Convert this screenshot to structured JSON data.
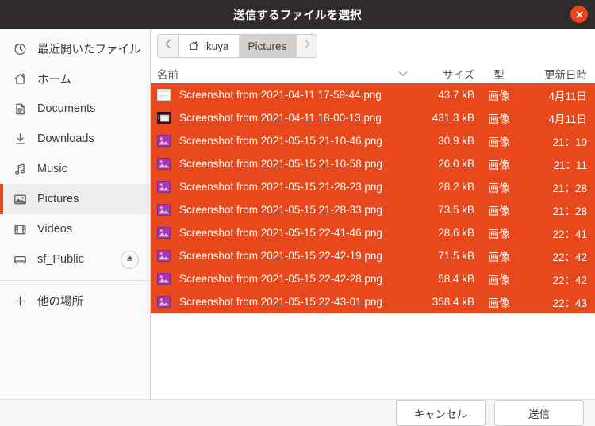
{
  "window": {
    "title": "送信するファイルを選択",
    "close_icon": "close-icon"
  },
  "sidebar": {
    "items": [
      {
        "label": "最近開いたファイル",
        "icon": "clock-icon",
        "selected": false,
        "eject": false
      },
      {
        "label": "ホーム",
        "icon": "home-icon",
        "selected": false,
        "eject": false
      },
      {
        "label": "Documents",
        "icon": "document-icon",
        "selected": false,
        "eject": false
      },
      {
        "label": "Downloads",
        "icon": "download-icon",
        "selected": false,
        "eject": false
      },
      {
        "label": "Music",
        "icon": "music-note-icon",
        "selected": false,
        "eject": false
      },
      {
        "label": "Pictures",
        "icon": "picture-icon",
        "selected": true,
        "eject": false
      },
      {
        "label": "Videos",
        "icon": "film-icon",
        "selected": false,
        "eject": false
      },
      {
        "label": "sf_Public",
        "icon": "drive-icon",
        "selected": false,
        "eject": true
      }
    ],
    "other_locations": {
      "label": "他の場所",
      "icon": "plus-icon"
    }
  },
  "pathbar": {
    "back_icon": "chevron-left-icon",
    "forward_icon": "chevron-right-icon",
    "crumbs": [
      {
        "label": "ikuya",
        "icon": "home-icon",
        "active": false
      },
      {
        "label": "Pictures",
        "icon": "",
        "active": true
      }
    ]
  },
  "columns": {
    "name": "名前",
    "size": "サイズ",
    "type": "型",
    "modified": "更新日時",
    "sort_icon": "chevron-down-icon"
  },
  "files": [
    {
      "name": "Screenshot from 2021-04-11 17-59-44.png",
      "size": "43.7 kB",
      "type": "画像",
      "modified": "4月11日",
      "thumb": "window-light",
      "selected": true
    },
    {
      "name": "Screenshot from 2021-04-11 18-00-13.png",
      "size": "431.3 kB",
      "type": "画像",
      "modified": "4月11日",
      "thumb": "desktop-dark",
      "selected": true
    },
    {
      "name": "Screenshot from 2021-05-15 21-10-46.png",
      "size": "30.9 kB",
      "type": "画像",
      "modified": "21：10",
      "thumb": "image-purple",
      "selected": true
    },
    {
      "name": "Screenshot from 2021-05-15 21-10-58.png",
      "size": "26.0 kB",
      "type": "画像",
      "modified": "21：11",
      "thumb": "image-purple",
      "selected": true
    },
    {
      "name": "Screenshot from 2021-05-15 21-28-23.png",
      "size": "28.2 kB",
      "type": "画像",
      "modified": "21：28",
      "thumb": "image-purple",
      "selected": true
    },
    {
      "name": "Screenshot from 2021-05-15 21-28-33.png",
      "size": "73.5 kB",
      "type": "画像",
      "modified": "21：28",
      "thumb": "image-purple",
      "selected": true
    },
    {
      "name": "Screenshot from 2021-05-15 22-41-46.png",
      "size": "28.6 kB",
      "type": "画像",
      "modified": "22：41",
      "thumb": "image-purple",
      "selected": true
    },
    {
      "name": "Screenshot from 2021-05-15 22-42-19.png",
      "size": "71.5 kB",
      "type": "画像",
      "modified": "22：42",
      "thumb": "image-purple",
      "selected": true
    },
    {
      "name": "Screenshot from 2021-05-15 22-42-28.png",
      "size": "58.4 kB",
      "type": "画像",
      "modified": "22：42",
      "thumb": "image-purple",
      "selected": true
    },
    {
      "name": "Screenshot from 2021-05-15 22-43-01.png",
      "size": "358.4 kB",
      "type": "画像",
      "modified": "22：43",
      "thumb": "image-purple",
      "selected": true
    }
  ],
  "footer": {
    "cancel_label": "キャンセル",
    "send_label": "送信"
  },
  "colors": {
    "accent_orange": "#e8491c",
    "titlebar_bg": "#2f2c2b",
    "selection_bg": "#e8491c",
    "sidebar_bg": "#fafafa",
    "sidebar_selected_bg": "#ededed",
    "footer_bg": "#f7f6f5"
  }
}
